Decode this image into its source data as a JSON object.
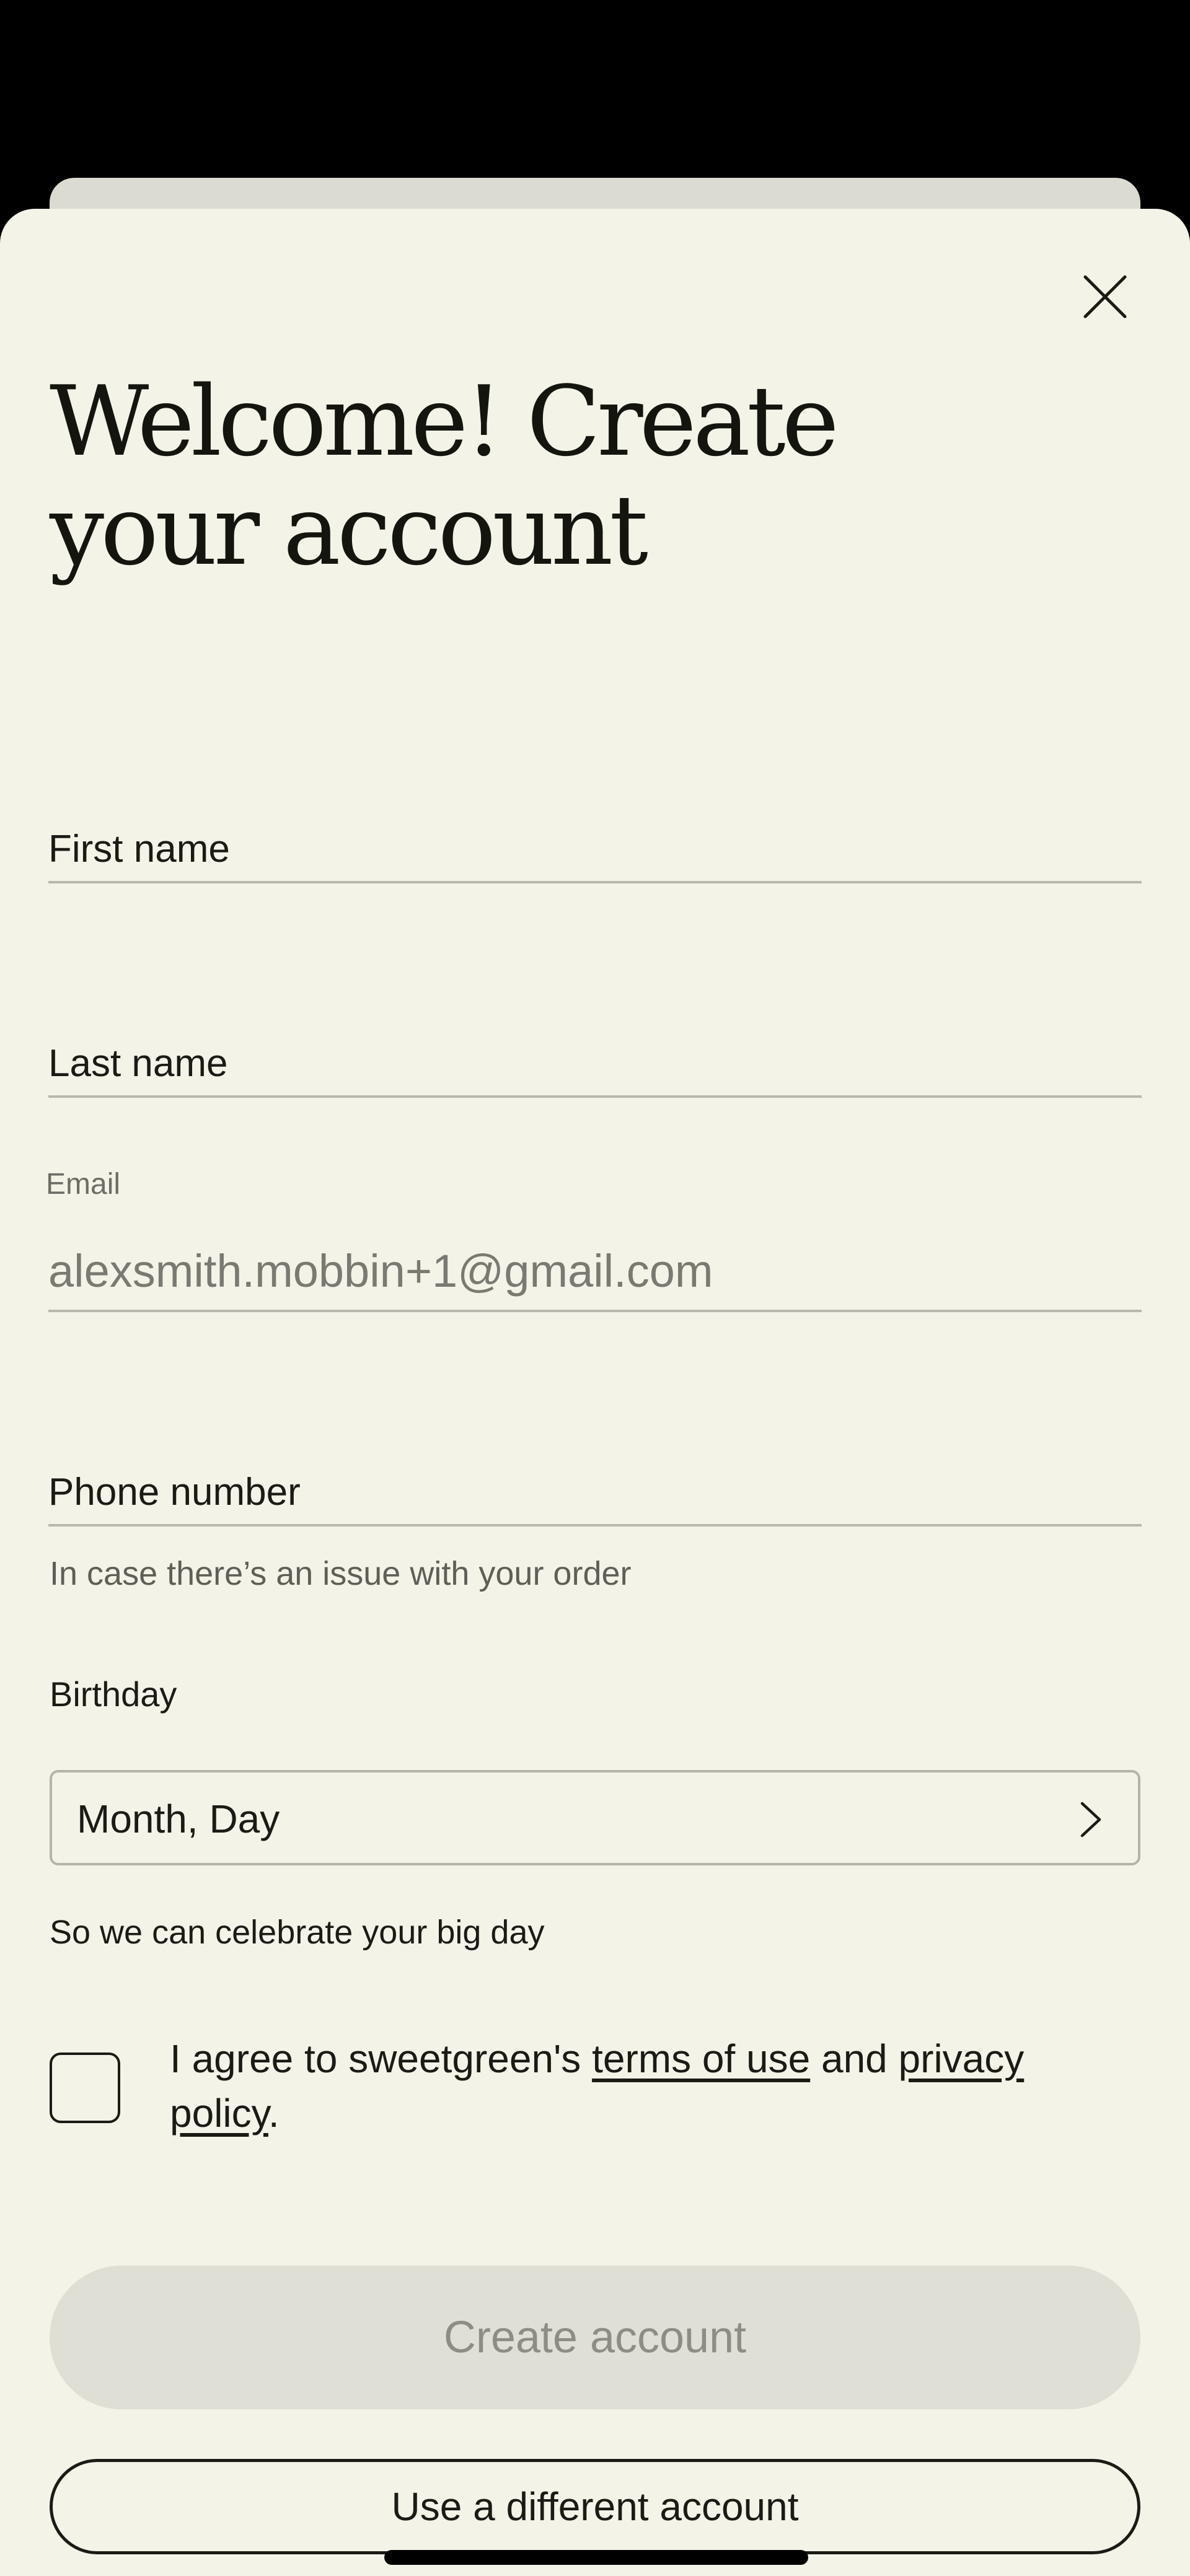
{
  "header": {
    "title": "Welcome! Create your account",
    "close_icon": "close-icon"
  },
  "form": {
    "first_name": {
      "label": "First name"
    },
    "last_name": {
      "label": "Last name"
    },
    "email": {
      "label": "Email",
      "value": "alexsmith.mobbin+1@gmail.com"
    },
    "phone": {
      "label": "Phone number",
      "helper": "In case there’s an issue with your order"
    },
    "birthday": {
      "label": "Birthday",
      "placeholder": "Month, Day",
      "chevron_icon": "chevron-right-icon",
      "helper": "So we can celebrate your big day"
    },
    "agreement": {
      "prefix": "I agree to sweetgreen's ",
      "terms_link": "terms of use",
      "middle": " and ",
      "privacy_link": "privacy policy",
      "suffix": "."
    }
  },
  "actions": {
    "create_account": "Create account",
    "different_account": "Use a different account"
  },
  "colors": {
    "sheet_background": "#f4f3e8",
    "backdrop": "#000000",
    "disabled_button": "#dfdfd6",
    "text": "#1b1b16"
  }
}
